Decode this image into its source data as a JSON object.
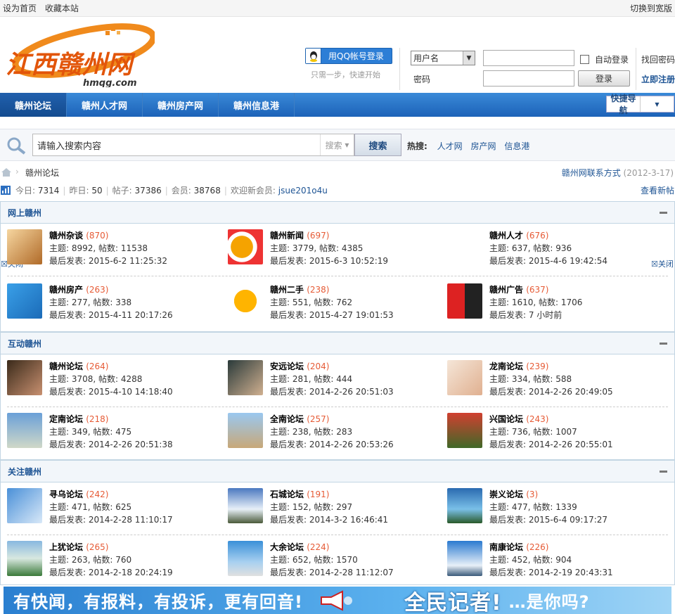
{
  "topbar": {
    "set_home": "设为首页",
    "bookmark": "收藏本站",
    "switch_width": "切换到宽版"
  },
  "header": {
    "logo_text": "江西赣州网",
    "logo_domain": "hmqg.com",
    "qq_login": "用QQ帐号登录",
    "qq_tip": "只需一步，快速开始",
    "username_select": "用户名",
    "password_label": "密码",
    "auto_login": "自动登录",
    "login_button": "登录",
    "find_password": "找回密码",
    "register": "立即注册"
  },
  "nav": {
    "items": [
      "赣州论坛",
      "赣州人才网",
      "赣州房产网",
      "赣州信息港"
    ],
    "quick_nav": "快捷导航"
  },
  "search": {
    "placeholder": "请输入搜索内容",
    "type": "搜索",
    "button": "搜索",
    "hot_label": "热搜:",
    "hot": [
      "人才网",
      "房产网",
      "信息港"
    ]
  },
  "breadcrumb": {
    "current": "赣州论坛",
    "contact": "赣州网联系方式",
    "contact_date": "(2012-3-17)"
  },
  "stats": {
    "today_label": "今日:",
    "today": "7314",
    "yesterday_label": "昨日:",
    "yesterday": "50",
    "posts_label": "帖子:",
    "posts": "37386",
    "members_label": "会员:",
    "members": "38768",
    "welcome_label": "欢迎新会员:",
    "new_member": "jsue201o4u",
    "view_new": "查看新帖"
  },
  "close_label": "关闭",
  "categories": [
    {
      "name": "网上赣州",
      "forums": [
        {
          "name": "赣州杂谈",
          "count": "(870)",
          "topics": "主题: 8992, 帖数: 11538",
          "last": "最后发表: 2015-6-2 11:25:32"
        },
        {
          "name": "赣州新闻",
          "count": "(697)",
          "topics": "主题: 3779, 帖数: 4385",
          "last": "最后发表: 2015-6-3 10:52:19"
        },
        {
          "name": "赣州人才",
          "count": "(676)",
          "topics": "主题: 637, 帖数: 936",
          "last": "最后发表: 2015-4-6 19:42:54"
        },
        {
          "name": "赣州房产",
          "count": "(263)",
          "topics": "主题: 277, 帖数: 338",
          "last": "最后发表: 2015-4-11 20:17:26"
        },
        {
          "name": "赣州二手",
          "count": "(238)",
          "topics": "主题: 551, 帖数: 762",
          "last": "最后发表: 2015-4-27 19:01:53"
        },
        {
          "name": "赣州广告",
          "count": "(637)",
          "topics": "主题: 1610, 帖数: 1706",
          "last": "最后发表: 7 小时前"
        }
      ]
    },
    {
      "name": "互动赣州",
      "forums": [
        {
          "name": "赣州论坛",
          "count": "(264)",
          "topics": "主题: 3708, 帖数: 4288",
          "last": "最后发表: 2015-4-10 14:18:40"
        },
        {
          "name": "安远论坛",
          "count": "(204)",
          "topics": "主题: 281, 帖数: 444",
          "last": "最后发表: 2014-2-26 20:51:03"
        },
        {
          "name": "龙南论坛",
          "count": "(239)",
          "topics": "主题: 334, 帖数: 588",
          "last": "最后发表: 2014-2-26 20:49:05"
        },
        {
          "name": "定南论坛",
          "count": "(218)",
          "topics": "主题: 349, 帖数: 475",
          "last": "最后发表: 2014-2-26 20:51:38"
        },
        {
          "name": "全南论坛",
          "count": "(257)",
          "topics": "主题: 238, 帖数: 283",
          "last": "最后发表: 2014-2-26 20:53:26"
        },
        {
          "name": "兴国论坛",
          "count": "(243)",
          "topics": "主题: 736, 帖数: 1007",
          "last": "最后发表: 2014-2-26 20:55:01"
        }
      ]
    },
    {
      "name": "关注赣州",
      "forums": [
        {
          "name": "寻乌论坛",
          "count": "(242)",
          "topics": "主题: 471, 帖数: 625",
          "last": "最后发表: 2014-2-28 11:10:17"
        },
        {
          "name": "石城论坛",
          "count": "(191)",
          "topics": "主题: 152, 帖数: 297",
          "last": "最后发表: 2014-3-2 16:46:41"
        },
        {
          "name": "崇义论坛",
          "count": "(3)",
          "topics": "主题: 477, 帖数: 1339",
          "last": "最后发表: 2015-6-4 09:17:27"
        },
        {
          "name": "上犹论坛",
          "count": "(265)",
          "topics": "主题: 263, 帖数: 760",
          "last": "最后发表: 2014-2-18 20:24:19"
        },
        {
          "name": "大余论坛",
          "count": "(224)",
          "topics": "主题: 652, 帖数: 1570",
          "last": "最后发表: 2014-2-28 11:12:07"
        },
        {
          "name": "南康论坛",
          "count": "(226)",
          "topics": "主题: 452, 帖数: 904",
          "last": "最后发表: 2014-2-19 20:43:31"
        }
      ]
    }
  ],
  "banner": {
    "part1": "有快闻，有报料，有投诉，更有回音!",
    "part2": "全民记者!",
    "part3": "…是你吗?"
  },
  "icons": [
    "qq-icon",
    "search-icon",
    "home-icon",
    "stats-icon",
    "collapse-icon",
    "megaphone-icon"
  ],
  "colors": {
    "nav": "#1c62b8",
    "link": "#1e5494",
    "count": "#e65b36",
    "logo": "#e8650a"
  }
}
